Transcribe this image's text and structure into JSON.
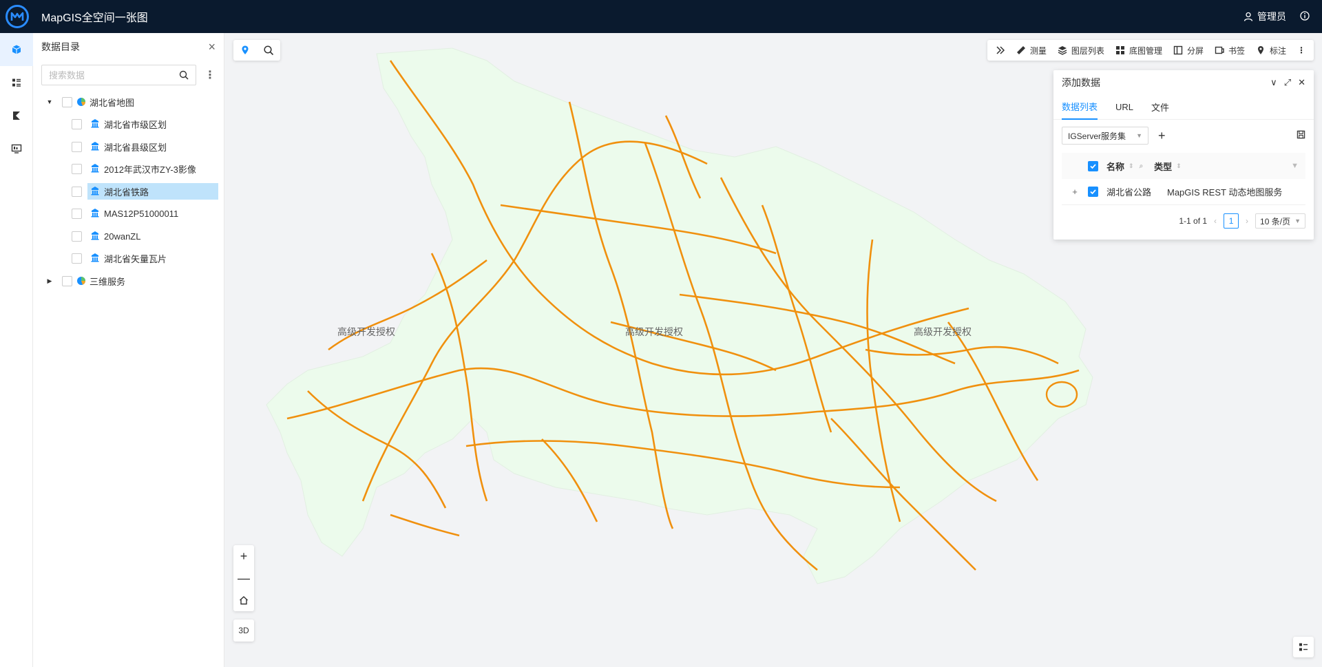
{
  "header": {
    "title": "MapGIS全空间一张图",
    "user": "管理员"
  },
  "rail": {
    "items": [
      "layers-cube-icon",
      "list-icon",
      "chart-icon",
      "monitor-icon"
    ]
  },
  "catalog": {
    "title": "数据目录",
    "search_placeholder": "搜索数据",
    "groups": [
      {
        "label": "湖北省地图",
        "expanded": true,
        "layers": [
          {
            "label": "湖北省市级区划",
            "selected": false
          },
          {
            "label": "湖北省县级区划",
            "selected": false
          },
          {
            "label": "2012年武汉市ZY-3影像",
            "selected": false
          },
          {
            "label": "湖北省铁路",
            "selected": true
          },
          {
            "label": "MAS12P51000011",
            "selected": false
          },
          {
            "label": "20wanZL",
            "selected": false
          },
          {
            "label": "湖北省矢量瓦片",
            "selected": false
          }
        ]
      },
      {
        "label": "三维服务",
        "expanded": false,
        "layers": []
      }
    ]
  },
  "map": {
    "watermark": "高级开发授权",
    "toolbar": [
      "测量",
      "图层列表",
      "底图管理",
      "分屏",
      "书签",
      "标注"
    ],
    "btn_3d": "3D",
    "colors": {
      "land": "#ecfbec",
      "roads": "#f0900e",
      "background": "#f2f3f5"
    }
  },
  "add_data": {
    "title": "添加数据",
    "tabs": [
      "数据列表",
      "URL",
      "文件"
    ],
    "source": "IGServer服务集",
    "columns": {
      "name": "名称",
      "type": "类型"
    },
    "rows": [
      {
        "name": "湖北省公路",
        "type": "MapGIS REST 动态地图服务"
      }
    ],
    "pager": {
      "summary": "1-1 of 1",
      "page": "1",
      "page_size": "10 条/页"
    }
  }
}
